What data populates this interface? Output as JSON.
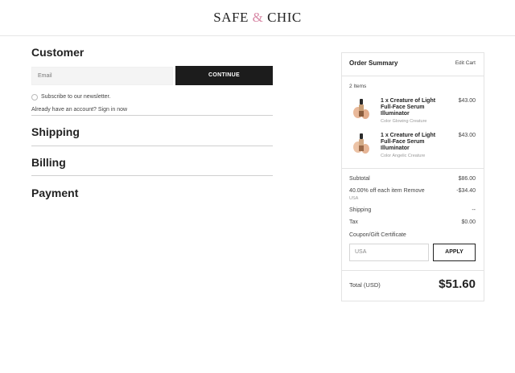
{
  "brand": {
    "logo_left": "SAFE ",
    "logo_amp": "&",
    "logo_right": " CHIC"
  },
  "checkout": {
    "customer": {
      "title": "Customer",
      "email_placeholder": "Email",
      "continue_label": "CONTINUE",
      "newsletter_label": "Subscribe to our newsletter.",
      "signin_text": "Already have an account? Sign in now"
    },
    "shipping_title": "Shipping",
    "billing_title": "Billing",
    "payment_title": "Payment"
  },
  "summary": {
    "title": "Order Summary",
    "edit_cart": "Edit Cart",
    "items_count": "2 Items",
    "items": [
      {
        "name_line1": "1 x Creature of Light",
        "name_line2": "Full-Face Serum",
        "name_line3": "Illuminator",
        "color": "Color Glowing Creature",
        "price": "$43.00"
      },
      {
        "name_line1": "1 x Creature of Light",
        "name_line2": "Full-Face Serum",
        "name_line3": "Illuminator",
        "color": "Color Angelic Creature",
        "price": "$43.00"
      }
    ],
    "subtotal_label": "Subtotal",
    "subtotal_value": "$86.00",
    "discount_label": "40.00% off each item Remove",
    "discount_sub": "USA",
    "discount_value": "-$34.40",
    "shipping_label": "Shipping",
    "shipping_value": "--",
    "tax_label": "Tax",
    "tax_value": "$0.00",
    "coupon_label": "Coupon/Gift Certificate",
    "coupon_placeholder": "USA",
    "apply_label": "APPLY",
    "total_label": "Total (USD)",
    "total_value": "$51.60"
  },
  "colors": {
    "accent_dark": "#1c1c1c",
    "logo_amp": "#d98ba8"
  }
}
